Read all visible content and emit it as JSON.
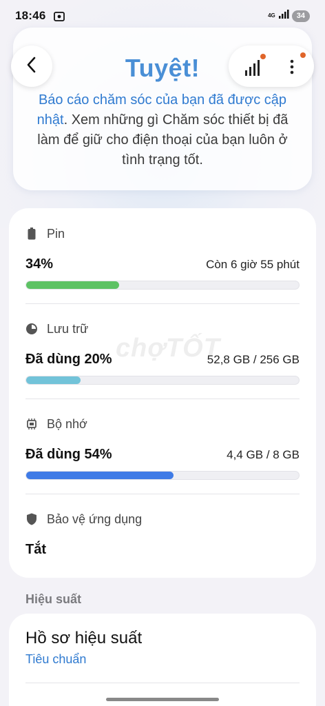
{
  "status_bar": {
    "time": "18:46",
    "network": "4G",
    "battery": "34"
  },
  "header": {
    "title": "Tuyệt!",
    "desc_highlight": "Báo cáo chăm sóc của bạn đã được cập nhật",
    "desc_rest": ". Xem những gì Chăm sóc thiết bị đã làm để giữ cho điện thoại của bạn luôn ở tình trạng tốt."
  },
  "stats": {
    "battery": {
      "label": "Pin",
      "value": "34%",
      "side": "Còn 6 giờ 55 phút",
      "percent": 34,
      "color": "#5dc264"
    },
    "storage": {
      "label": "Lưu trữ",
      "value": "Đã dùng 20%",
      "side": "52,8 GB / 256 GB",
      "percent": 20,
      "color": "#72c3d9"
    },
    "memory": {
      "label": "Bộ nhớ",
      "value": "Đã dùng 54%",
      "side": "4,4 GB / 8 GB",
      "percent": 54,
      "color": "#3f7be6"
    },
    "app_protection": {
      "label": "Bảo vệ ứng dụng",
      "value": "Tắt"
    }
  },
  "performance": {
    "group_label": "Hiệu suất",
    "profile_title": "Hồ sơ hiệu suất",
    "profile_value": "Tiêu chuẩn"
  },
  "watermark": "chợTỐT",
  "colors": {
    "accent": "#2f7ad0",
    "title": "#4a8fd6",
    "badge": "#e0652a"
  }
}
